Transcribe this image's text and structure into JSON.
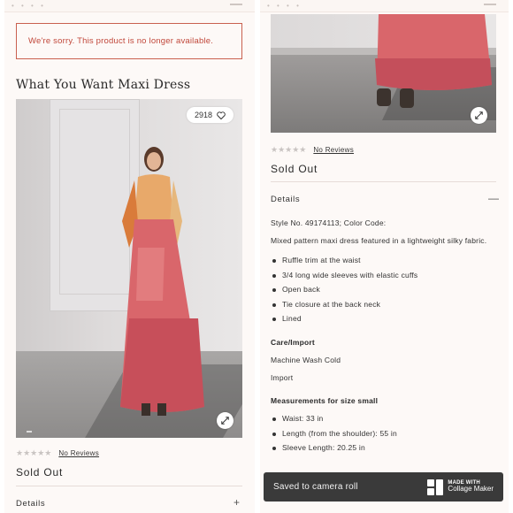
{
  "left": {
    "alert_text": "We're sorry. This product is no longer available.",
    "product_title": "What You Want Maxi Dress",
    "like_count": "2918",
    "reviews_link": "No Reviews",
    "status": "Sold Out",
    "details_label": "Details",
    "details_toggle": "+"
  },
  "right": {
    "reviews_link": "No Reviews",
    "status": "Sold Out",
    "details_label": "Details",
    "details_toggle": "—",
    "style_line": "Style No. 49174113; Color Code:",
    "description": "Mixed pattern maxi dress featured in a lightweight silky fabric.",
    "features": [
      "Ruffle trim at the waist",
      "3/4 long wide sleeves with elastic cuffs",
      "Open back",
      "Tie closure at the back neck",
      "Lined"
    ],
    "care_heading": "Care/Import",
    "care_wash": "Machine Wash Cold",
    "care_import": "Import",
    "measurements_heading": "Measurements for size small",
    "measurements": [
      "Waist: 33 in",
      "Length (from the shoulder): 55 in",
      "Sleeve Length: 20.25 in"
    ]
  },
  "toast": {
    "message": "Saved to camera roll",
    "brand_line1": "MADE WITH",
    "brand_line2": "Collage Maker"
  },
  "icons": {
    "heart": "heart-icon",
    "expand": "expand-icon",
    "star": "star-icon"
  },
  "colors": {
    "alert_border": "#c9604f",
    "alert_text": "#c1483b",
    "page_bg": "#fdf9f7",
    "toast_bg": "#3a3a3a"
  }
}
